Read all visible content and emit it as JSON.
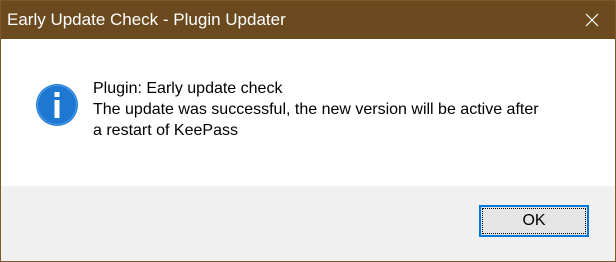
{
  "window": {
    "title": "Early Update Check - Plugin Updater",
    "close_symbol": "✕"
  },
  "message": {
    "line1": "Plugin: Early update check",
    "line2": "The update was successful, the new version will be active after",
    "line3": "a restart of KeePass"
  },
  "buttons": {
    "ok_label": "OK"
  },
  "icons": {
    "info": "info-icon",
    "close": "close-icon"
  },
  "colors": {
    "titlebar": "#6b4a1f",
    "info_icon": "#1e78d2",
    "footer": "#f0f0f0",
    "ok_border": "#0078d7"
  }
}
